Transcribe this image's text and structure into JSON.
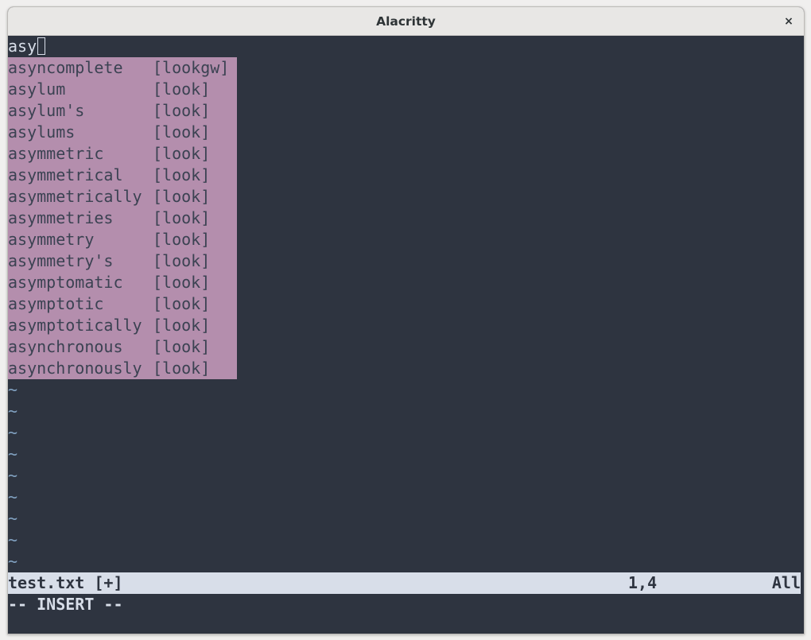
{
  "window": {
    "title": "Alacritty",
    "close_glyph": "×"
  },
  "editor": {
    "line1_text": "asy",
    "completion_items": [
      {
        "word": "asyncomplete",
        "menu": "[lookgw]"
      },
      {
        "word": "asylum",
        "menu": "[look]"
      },
      {
        "word": "asylum's",
        "menu": "[look]"
      },
      {
        "word": "asylums",
        "menu": "[look]"
      },
      {
        "word": "asymmetric",
        "menu": "[look]"
      },
      {
        "word": "asymmetrical",
        "menu": "[look]"
      },
      {
        "word": "asymmetrically",
        "menu": "[look]"
      },
      {
        "word": "asymmetries",
        "menu": "[look]"
      },
      {
        "word": "asymmetry",
        "menu": "[look]"
      },
      {
        "word": "asymmetry's",
        "menu": "[look]"
      },
      {
        "word": "asymptomatic",
        "menu": "[look]"
      },
      {
        "word": "asymptotic",
        "menu": "[look]"
      },
      {
        "word": "asymptotically",
        "menu": "[look]"
      },
      {
        "word": "asynchronous",
        "menu": "[look]"
      },
      {
        "word": "asynchronously",
        "menu": "[look]"
      }
    ],
    "tilde_char": "~",
    "empty_line_count": 9
  },
  "statusline": {
    "filename": "test.txt [+]",
    "position": "1,4",
    "percent": "All"
  },
  "mode": "-- INSERT --",
  "colors": {
    "background": "#2e3440",
    "foreground": "#d8dee9",
    "popup_bg": "#b48ead",
    "popup_fg": "#3b4252",
    "tilde": "#81a1c1",
    "statusline_bg": "#d8dee9"
  }
}
